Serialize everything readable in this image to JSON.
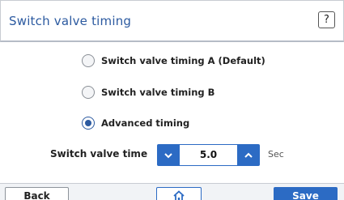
{
  "dialog": {
    "title": "Switch valve timing",
    "help_label": "?"
  },
  "options": [
    {
      "label": "Switch valve timing A (Default)",
      "selected": false
    },
    {
      "label": "Switch valve timing B",
      "selected": false
    },
    {
      "label": "Advanced timing",
      "selected": true
    }
  ],
  "switch_valve_time": {
    "label": "Switch valve time",
    "value": "5.0",
    "unit": "Sec"
  },
  "footer": {
    "back_label": "Back",
    "save_label": "Save",
    "home_icon": "home-icon"
  },
  "colors": {
    "accent": "#2c6bc4",
    "title_text": "#2c5aa0"
  }
}
